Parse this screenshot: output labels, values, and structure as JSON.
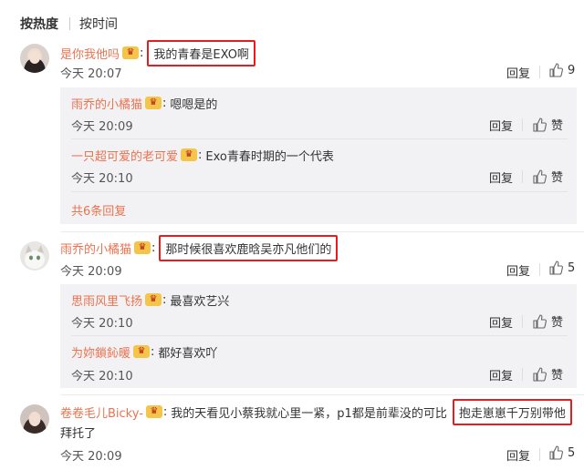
{
  "sort": {
    "active": "按热度",
    "other": "按时间"
  },
  "c1": {
    "user": "是你我他吗",
    "text": "我的青春是EXO啊",
    "time": "今天 20:07",
    "reply": "回复",
    "likes": "9",
    "subs": [
      {
        "user": "雨乔的小橘猫",
        "text": "嗯嗯是的",
        "time": "今天 20:09",
        "reply": "回复",
        "like": "赞"
      },
      {
        "user": "一只超可爱的老可爱",
        "text": "Exo青春时期的一个代表",
        "time": "今天 20:10",
        "reply": "回复",
        "like": "赞"
      }
    ],
    "more": "共6条回复"
  },
  "c2": {
    "user": "雨乔的小橘猫",
    "text": "那时候很喜欢鹿晗吴亦凡他们的",
    "time": "今天 20:09",
    "reply": "回复",
    "likes": "5",
    "subs": [
      {
        "user": "思雨风里飞扬",
        "text": "最喜欢艺兴",
        "time": "今天 20:10",
        "reply": "回复",
        "like": "赞"
      },
      {
        "user": "为妳鎖鈊暖",
        "text": "都好喜欢吖",
        "time": "今天 20:10",
        "reply": "回复",
        "like": "赞"
      }
    ]
  },
  "c3": {
    "user": "卷卷毛儿Bicky-",
    "text": "我的天看见小蔡我就心里一紧，p1都是前辈没的可比",
    "text_hl": "抱走崽崽千万别带他",
    "text2": "拜托了",
    "time": "今天 20:09",
    "reply": "回复",
    "likes": "5"
  },
  "vip_label": "♛",
  "colors": {
    "username": "#eb7350",
    "highlight": "#e02020",
    "panel": "#f2f2f5"
  }
}
